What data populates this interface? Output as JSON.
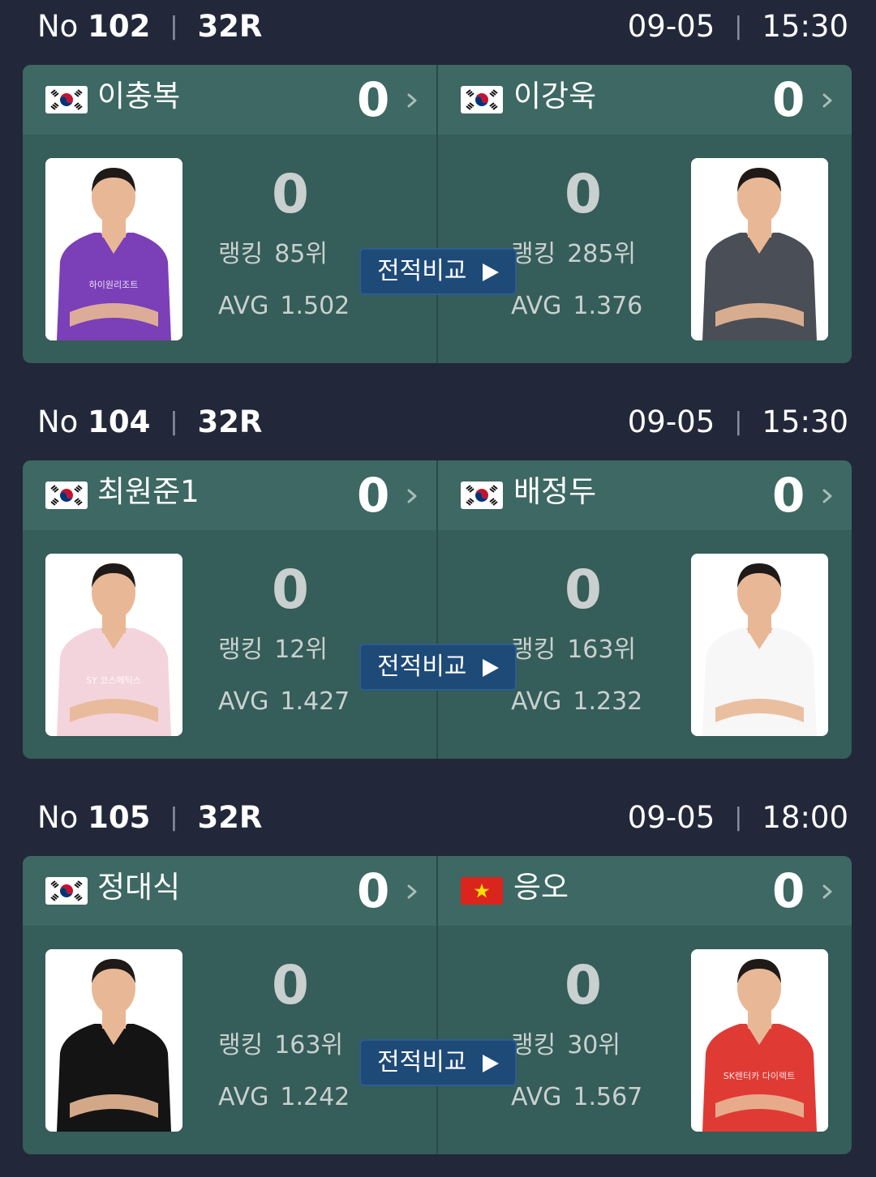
{
  "matches": [
    {
      "no_label": "No",
      "number": "102",
      "round": "32R",
      "date": "09-05",
      "time": "15:30",
      "compare_label": "전적비교",
      "left": {
        "flag": "KR",
        "name": "이충복",
        "score": "0",
        "big_score": "0",
        "ranking_label": "랭킹",
        "ranking": "85위",
        "avg_label": "AVG",
        "avg": "1.502",
        "jersey_color": "#7b3fb8",
        "jersey_text": "하이원리조트"
      },
      "right": {
        "flag": "KR",
        "name": "이강욱",
        "score": "0",
        "big_score": "0",
        "ranking_label": "랭킹",
        "ranking": "285위",
        "avg_label": "AVG",
        "avg": "1.376",
        "jersey_color": "#4a4e56",
        "jersey_text": ""
      }
    },
    {
      "no_label": "No",
      "number": "104",
      "round": "32R",
      "date": "09-05",
      "time": "15:30",
      "compare_label": "전적비교",
      "left": {
        "flag": "KR",
        "name": "최원준1",
        "score": "0",
        "big_score": "0",
        "ranking_label": "랭킹",
        "ranking": "12위",
        "avg_label": "AVG",
        "avg": "1.427",
        "jersey_color": "#f4d4dc",
        "jersey_text": "SY 코스메틱스"
      },
      "right": {
        "flag": "KR",
        "name": "배정두",
        "score": "0",
        "big_score": "0",
        "ranking_label": "랭킹",
        "ranking": "163위",
        "avg_label": "AVG",
        "avg": "1.232",
        "jersey_color": "#f7f7f7",
        "jersey_text": ""
      }
    },
    {
      "no_label": "No",
      "number": "105",
      "round": "32R",
      "date": "09-05",
      "time": "18:00",
      "compare_label": "전적비교",
      "left": {
        "flag": "KR",
        "name": "정대식",
        "score": "0",
        "big_score": "0",
        "ranking_label": "랭킹",
        "ranking": "163위",
        "avg_label": "AVG",
        "avg": "1.242",
        "jersey_color": "#141414",
        "jersey_text": ""
      },
      "right": {
        "flag": "VN",
        "name": "응오",
        "score": "0",
        "big_score": "0",
        "ranking_label": "랭킹",
        "ranking": "30위",
        "avg_label": "AVG",
        "avg": "1.567",
        "jersey_color": "#e03a35",
        "jersey_text": "SK렌터카 다이렉트"
      }
    }
  ],
  "colors": {
    "background": "#222839",
    "card": "#355d59",
    "card_header": "#3d6863",
    "compare_button": "#1e4a78"
  },
  "icons": [
    "kr-flag-icon",
    "vn-flag-icon",
    "chevron-right-icon",
    "play-triangle-icon"
  ]
}
